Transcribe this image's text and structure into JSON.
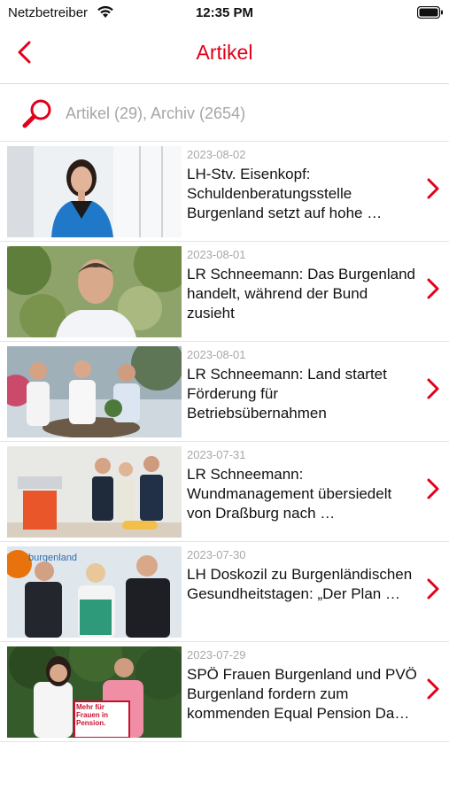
{
  "status_bar": {
    "carrier": "Netzbetreiber",
    "time": "12:35 PM"
  },
  "nav": {
    "title": "Artikel",
    "accent_color": "#e2001a"
  },
  "search": {
    "placeholder": "Artikel (29), Archiv (2654)"
  },
  "articles": [
    {
      "date": "2023-08-02",
      "title": "LH-Stv. Eisenkopf: Schuldenberatungsstelle Burgenland setzt auf hohe …"
    },
    {
      "date": "2023-08-01",
      "title": "LR Schneemann: Das Burgenland handelt, während der Bund zusieht"
    },
    {
      "date": "2023-08-01",
      "title": "LR Schneemann: Land startet Förderung für Betriebsübernahmen"
    },
    {
      "date": "2023-07-31",
      "title": "LR Schneemann: Wundmanagement übersiedelt von Draßburg nach …"
    },
    {
      "date": "2023-07-30",
      "title": "LH Doskozil zu Burgenländischen Gesundheitstagen: „Der Plan …"
    },
    {
      "date": "2023-07-29",
      "title": "SPÖ Frauen Burgenland und PVÖ Burgenland fordern zum kommenden Equal Pension Da…"
    }
  ],
  "thumb_text": {
    "article_4_sign": "burgenland",
    "article_5_sign": "Mehr für Frauen in Pension."
  }
}
